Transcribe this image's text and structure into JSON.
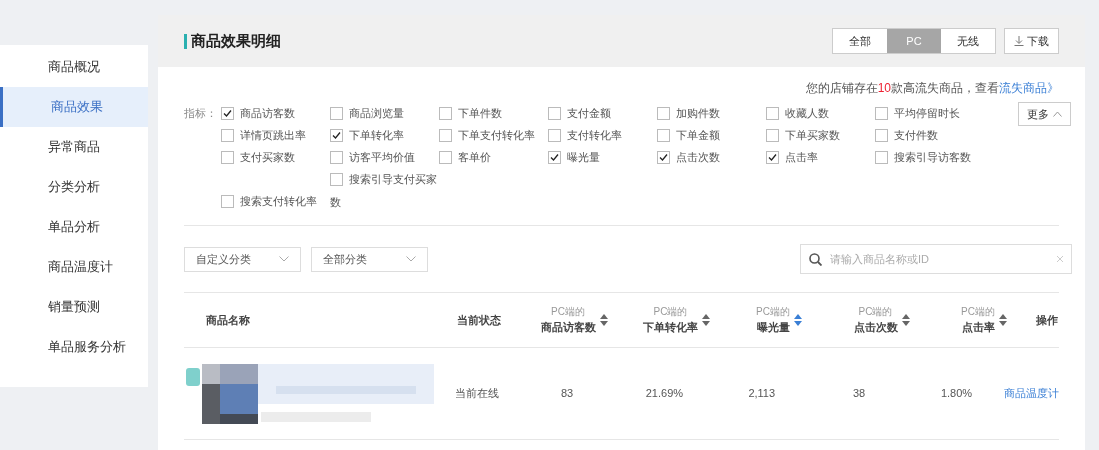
{
  "sidebar": {
    "items": [
      {
        "label": "商品概况",
        "selected": false
      },
      {
        "label": "商品效果",
        "selected": true
      },
      {
        "label": "异常商品",
        "selected": false
      },
      {
        "label": "分类分析",
        "selected": false
      },
      {
        "label": "单品分析",
        "selected": false
      },
      {
        "label": "商品温度计",
        "selected": false
      },
      {
        "label": "销量预测",
        "selected": false
      },
      {
        "label": "单品服务分析",
        "selected": false
      }
    ]
  },
  "header": {
    "title": "商品效果明细",
    "segments": [
      {
        "label": "全部",
        "selected": false
      },
      {
        "label": "PC",
        "selected": true
      },
      {
        "label": "无线",
        "selected": false
      }
    ],
    "download": "下载"
  },
  "notice": {
    "before": "您的店铺存在",
    "count": "10",
    "after": "款高流失商品，查看",
    "link": "流失商品》"
  },
  "metrics": {
    "label": "指标：",
    "more": "更多",
    "rows": [
      [
        {
          "kind": "checkbox",
          "label": "商品访客数",
          "checked": true
        },
        {
          "kind": "checkbox",
          "label": "商品浏览量",
          "checked": false
        },
        {
          "kind": "checkbox",
          "label": "下单件数",
          "checked": false
        },
        {
          "kind": "checkbox",
          "label": "支付金额",
          "checked": false
        },
        {
          "kind": "checkbox",
          "label": "加购件数",
          "checked": false
        },
        {
          "kind": "checkbox",
          "label": "收藏人数",
          "checked": false
        },
        {
          "kind": "checkbox",
          "label": "平均停留时长",
          "checked": false
        }
      ],
      [
        {
          "kind": "checkbox",
          "label": "详情页跳出率",
          "checked": false
        },
        {
          "kind": "checkbox",
          "label": "下单转化率",
          "checked": true
        },
        {
          "kind": "checkbox",
          "label": "下单支付转化率",
          "checked": false
        },
        {
          "kind": "checkbox",
          "label": "支付转化率",
          "checked": false
        },
        {
          "kind": "checkbox",
          "label": "下单金额",
          "checked": false
        },
        {
          "kind": "checkbox",
          "label": "下单买家数",
          "checked": false
        },
        {
          "kind": "checkbox",
          "label": "支付件数",
          "checked": false
        }
      ],
      [
        {
          "kind": "checkbox",
          "label": "支付买家数",
          "checked": false
        },
        {
          "kind": "checkbox",
          "label": "访客平均价值",
          "checked": false
        },
        {
          "kind": "checkbox",
          "label": "客单价",
          "checked": false
        },
        {
          "kind": "checkbox",
          "label": "曝光量",
          "checked": true
        },
        {
          "kind": "checkbox",
          "label": "点击次数",
          "checked": true
        },
        {
          "kind": "checkbox",
          "label": "点击率",
          "checked": true
        },
        {
          "kind": "checkbox",
          "label": "搜索引导访客数",
          "checked": false
        }
      ],
      [
        {
          "kind": "empty"
        },
        {
          "kind": "checkbox",
          "label": "搜索引导支付买家",
          "checked": false
        }
      ],
      [
        {
          "kind": "checkbox",
          "label": "搜索支付转化率",
          "checked": false
        },
        {
          "kind": "text",
          "label": "数"
        }
      ]
    ]
  },
  "filters": [
    {
      "value": "自定义分类"
    },
    {
      "value": "全部分类"
    }
  ],
  "search": {
    "placeholder": "请输入商品名称或ID"
  },
  "table": {
    "columns": [
      {
        "kind": "plain",
        "label": "商品名称"
      },
      {
        "kind": "plain",
        "label": "当前状态"
      },
      {
        "kind": "metric",
        "prefix": "PC端的",
        "label": "商品访客数",
        "sorted": false
      },
      {
        "kind": "metric",
        "prefix": "PC端的",
        "label": "下单转化率",
        "sorted": false
      },
      {
        "kind": "metric",
        "prefix": "PC端的",
        "label": "曝光量",
        "sorted": true
      },
      {
        "kind": "metric",
        "prefix": "PC端的",
        "label": "点击次数",
        "sorted": false
      },
      {
        "kind": "metric",
        "prefix": "PC端的",
        "label": "点击率",
        "sorted": false
      },
      {
        "kind": "plain",
        "label": "操作"
      }
    ],
    "rows": [
      {
        "status": "当前在线",
        "values": [
          "83",
          "21.69%",
          "2,113",
          "38",
          "1.80%"
        ],
        "actions": [
          "商品温度计"
        ]
      }
    ]
  }
}
